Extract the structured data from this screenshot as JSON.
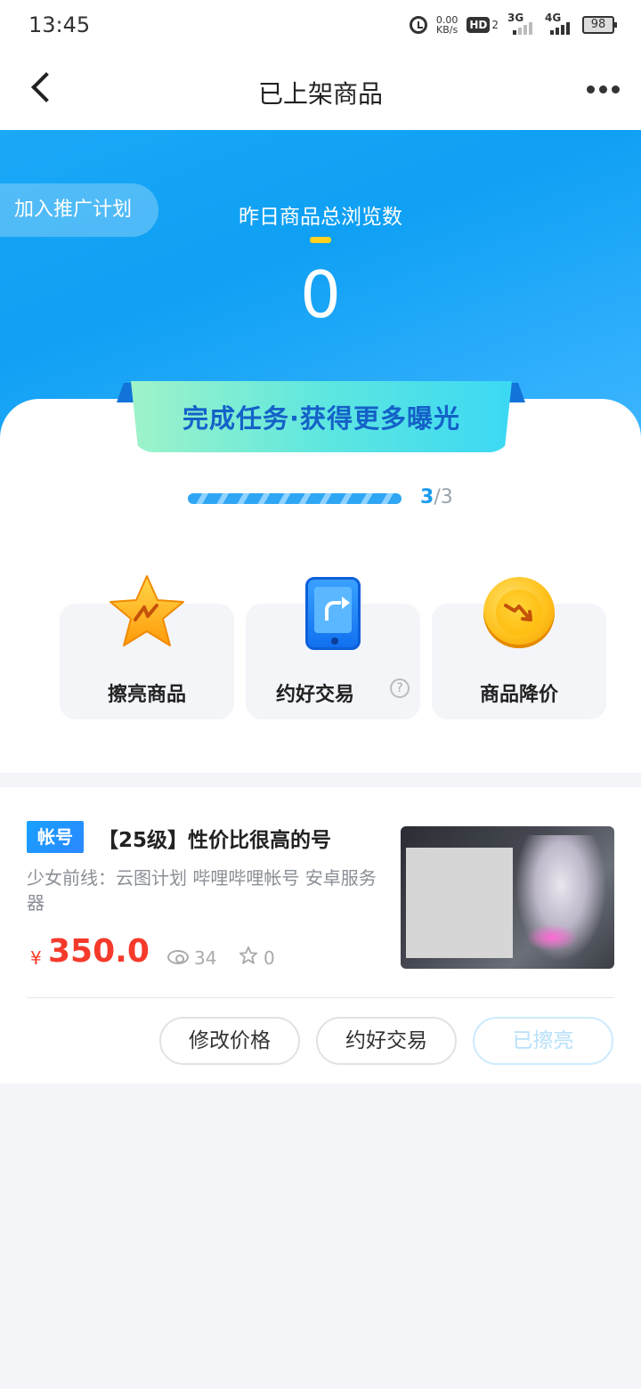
{
  "status_bar": {
    "time": "13:45",
    "net_speed_value": "0.00",
    "net_speed_unit": "KB/s",
    "hd_label": "HD",
    "hd_sub": "2",
    "signal_3g": "3G",
    "signal_4g": "4G",
    "battery": "98"
  },
  "nav": {
    "title": "已上架商品"
  },
  "hero": {
    "promo_label": "加入推广计划",
    "label": "昨日商品总浏览数",
    "value": "0"
  },
  "task": {
    "banner": "完成任务·获得更多曝光",
    "progress_done": "3",
    "progress_total": "/3",
    "progress_fraction": 1.0,
    "cards": [
      {
        "label": "擦亮商品",
        "icon": "star-icon"
      },
      {
        "label": "约好交易",
        "icon": "phone-share-icon",
        "help": "?"
      },
      {
        "label": "商品降价",
        "icon": "coin-down-icon"
      }
    ]
  },
  "listing": {
    "tag": "帐号",
    "title": "【25级】性价比很高的号",
    "description": "少女前线：云图计划   哔哩哔哩帐号   安卓服务器",
    "price_symbol": "¥",
    "price": "350.0",
    "views": "34",
    "stars": "0",
    "buttons": {
      "edit_price": "修改价格",
      "agree_trade": "约好交易",
      "polished": "已擦亮"
    }
  },
  "colors": {
    "hero_blue": "#1ba8f6",
    "price_red": "#f53a2b",
    "progress_blue": "#1b9bf0",
    "banner_text": "#1461c8"
  }
}
